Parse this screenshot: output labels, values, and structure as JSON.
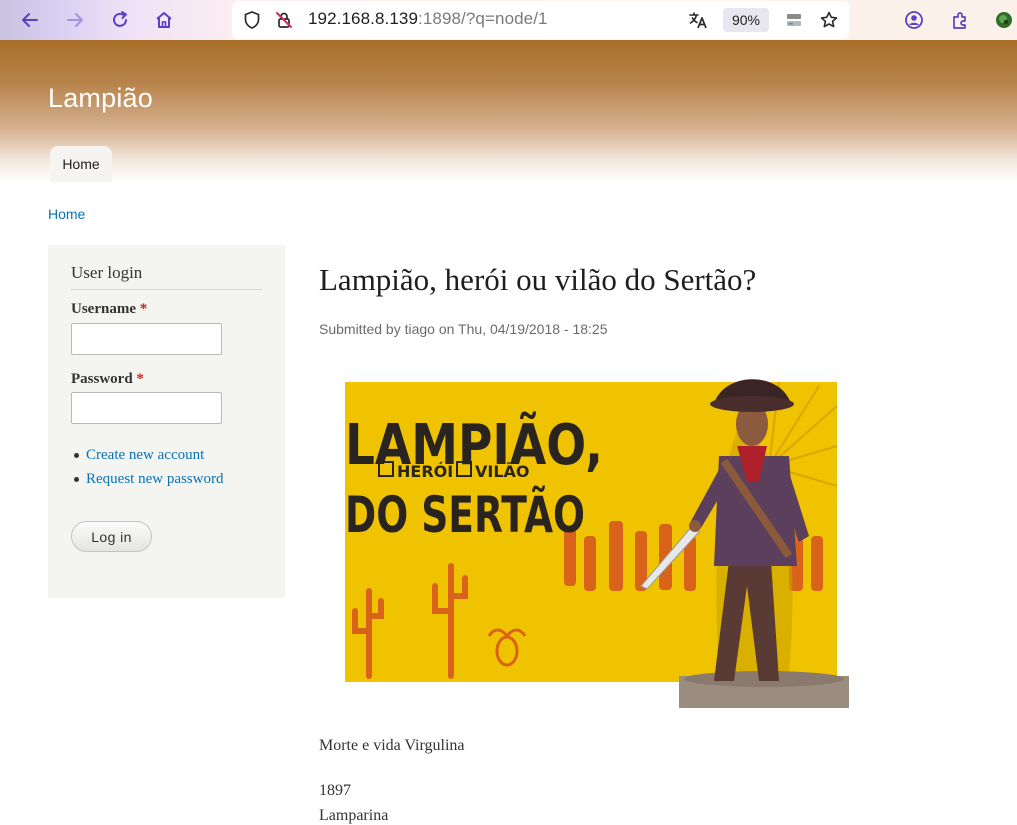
{
  "browser": {
    "url_host": "192.168.8.139",
    "url_rest": ":1898/?q=node/1",
    "zoom": "90%"
  },
  "site": {
    "name": "Lampião",
    "nav": [
      {
        "label": "Home"
      }
    ]
  },
  "breadcrumb": {
    "home": "Home"
  },
  "sidebar": {
    "title": "User login",
    "username_label": "Username",
    "password_label": "Password",
    "required_mark": "*",
    "links": [
      {
        "label": "Create new account"
      },
      {
        "label": "Request new password"
      }
    ],
    "login_button": "Log in"
  },
  "node": {
    "title": "Lampião, herói ou vilão do Sertão?",
    "submitted": "Submitted by tiago on Thu, 04/19/2018 - 18:25",
    "image_text": {
      "line1": "LAMPIÃO,",
      "opt1": "HERÓI",
      "opt2": "VILÃO",
      "line2": "DO SERTÃO"
    },
    "paragraphs": [
      "Morte e vida Virgulina",
      "1897",
      "Lamparina"
    ]
  },
  "colors": {
    "link": "#0a72b5",
    "header_top": "#a96f29",
    "poster_yellow": "#f0c300"
  }
}
